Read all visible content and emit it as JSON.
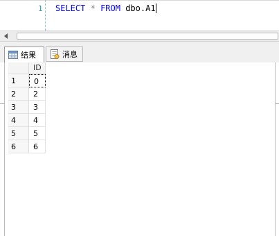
{
  "editor": {
    "line_number": "1",
    "code": {
      "kw_select": "SELECT",
      "star": "*",
      "kw_from": "FROM",
      "table": "dbo.A1"
    }
  },
  "tabs": [
    {
      "label": "结果",
      "icon": "grid-icon",
      "active": true
    },
    {
      "label": "消息",
      "icon": "message-icon",
      "active": false
    }
  ],
  "results": {
    "columns": [
      "ID"
    ],
    "rows": [
      {
        "num": "1",
        "ID": "0"
      },
      {
        "num": "2",
        "ID": "2"
      },
      {
        "num": "3",
        "ID": "3"
      },
      {
        "num": "4",
        "ID": "4"
      },
      {
        "num": "5",
        "ID": "5"
      },
      {
        "num": "6",
        "ID": "6"
      }
    ]
  }
}
